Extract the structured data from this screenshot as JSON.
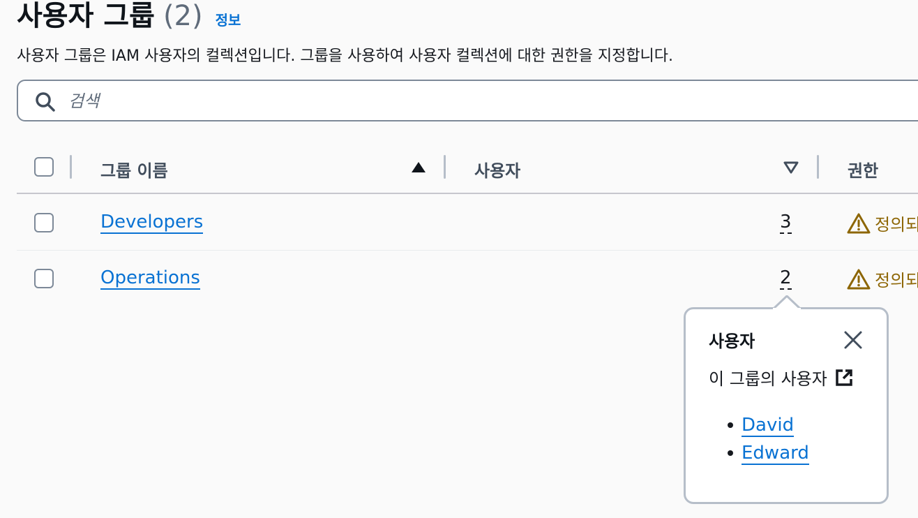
{
  "header": {
    "title": "사용자 그룹",
    "count": "(2)",
    "info_link": "정보",
    "description": "사용자 그룹은 IAM 사용자의 컬렉션입니다. 그룹을 사용하여 사용자 컬렉션에 대한 권한을 지정합니다."
  },
  "search": {
    "placeholder": "검색",
    "value": "",
    "icon": "search-icon"
  },
  "table": {
    "columns": [
      {
        "label": "그룹 이름",
        "sort": "ascending"
      },
      {
        "label": "사용자",
        "sort": "descending"
      },
      {
        "label": "권한"
      }
    ],
    "rows": [
      {
        "name": "Developers",
        "users": "3",
        "permissions": "정의되"
      },
      {
        "name": "Operations",
        "users": "2",
        "permissions": "정의되"
      }
    ]
  },
  "popover": {
    "title": "사용자",
    "subtitle": "이 그룹의 사용자",
    "users": [
      "David",
      "Edward"
    ]
  },
  "colors": {
    "link": "#0972d3",
    "warning": "#8d6605",
    "border": "#7d8998",
    "text": "#16191f"
  }
}
